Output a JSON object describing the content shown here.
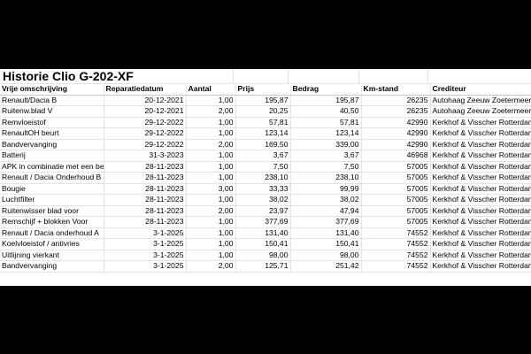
{
  "sheet": {
    "title": "Historie Clio G-202-XF",
    "columns": [
      "Vrije omschrijving",
      "Reparatiedatum",
      "Aantal",
      "Prijs",
      "Bedrag",
      "Km-stand",
      "Crediteur"
    ],
    "rows": [
      [
        "Renault/Dacia B",
        "20-12-2021",
        "1,00",
        "195,87",
        "195,87",
        "26235",
        "Autohaag Zeeuw Zoetermeer"
      ],
      [
        "Ruitenw.blad V",
        "20-12-2021",
        "2,00",
        "20,25",
        "40,50",
        "26235",
        "Autohaag Zeeuw Zoetermeer"
      ],
      [
        "Remvloeistof",
        "29-12-2022",
        "1,00",
        "57,81",
        "57,81",
        "42990",
        "Kerkhof & Visscher Rotterdam"
      ],
      [
        "RenaultOH beurt",
        "29-12-2022",
        "1,00",
        "123,14",
        "123,14",
        "42990",
        "Kerkhof & Visscher Rotterdam"
      ],
      [
        "Bandvervanging",
        "29-12-2022",
        "2,00",
        "169,50",
        "339,00",
        "42990",
        "Kerkhof & Visscher Rotterdam"
      ],
      [
        "Batterij",
        "31-3-2023",
        "1,00",
        "3,67",
        "3,67",
        "46968",
        "Kerkhof & Visscher Rotterdam"
      ],
      [
        "APK in combinatie met een beurt",
        "28-11-2023",
        "1,00",
        "7,50",
        "7,50",
        "57005",
        "Kerkhof & Visscher Rotterdam"
      ],
      [
        "Renault / Dacia Onderhoud B",
        "28-11-2023",
        "1,00",
        "238,10",
        "238,10",
        "57005",
        "Kerkhof & Visscher Rotterdam"
      ],
      [
        "Bougie",
        "28-11-2023",
        "3,00",
        "33,33",
        "99,99",
        "57005",
        "Kerkhof & Visscher Rotterdam"
      ],
      [
        "Luchtfilter",
        "28-11-2023",
        "1,00",
        "38,02",
        "38,02",
        "57005",
        "Kerkhof & Visscher Rotterdam"
      ],
      [
        "Ruitenwisser blad voor",
        "28-11-2023",
        "2,00",
        "23,97",
        "47,94",
        "57005",
        "Kerkhof & Visscher Rotterdam"
      ],
      [
        "Remschijf + blokken Voor",
        "28-11-2023",
        "1,00",
        "377,69",
        "377,69",
        "57005",
        "Kerkhof & Visscher Rotterdam"
      ],
      [
        "Renault / Dacia onderhoud A",
        "3-1-2025",
        "1,00",
        "131,40",
        "131,40",
        "74552",
        "Kerkhof & Visscher Rotterdam"
      ],
      [
        "Koelvloeistof / antivries",
        "3-1-2025",
        "1,00",
        "150,41",
        "150,41",
        "74552",
        "Kerkhof & Visscher Rotterdam"
      ],
      [
        "Uitlijning vierkant",
        "3-1-2025",
        "1,00",
        "98,00",
        "98,00",
        "74552",
        "Kerkhof & Visscher Rotterdam"
      ],
      [
        "Bandvervanging",
        "3-1-2025",
        "2,00",
        "125,71",
        "251,42",
        "74552",
        "Kerkhof & Visscher Rotterdam"
      ]
    ]
  }
}
